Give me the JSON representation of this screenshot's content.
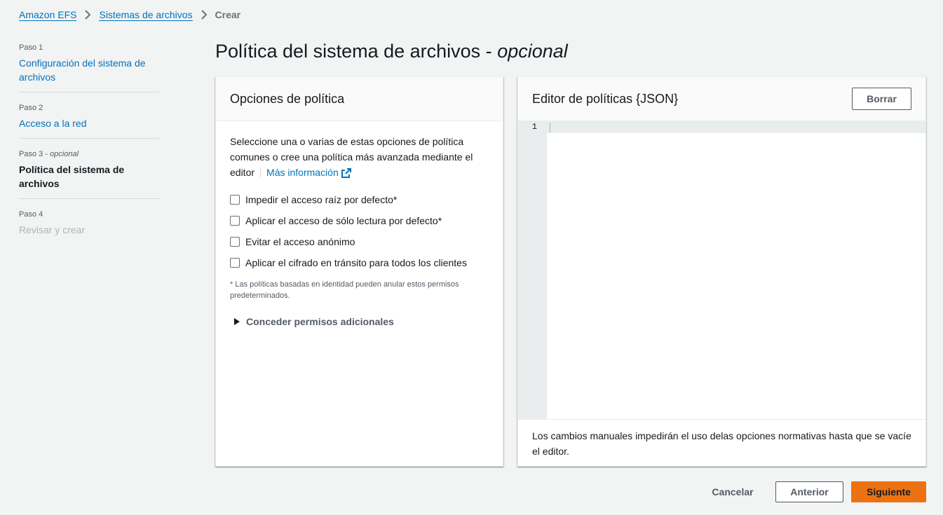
{
  "breadcrumb": {
    "items": [
      "Amazon EFS",
      "Sistemas de archivos"
    ],
    "current": "Crear"
  },
  "steps": [
    {
      "num": "Paso 1",
      "title": "Configuración del sistema de archivos",
      "state": "link"
    },
    {
      "num": "Paso 2",
      "title": "Acceso a la red",
      "state": "link"
    },
    {
      "num": "Paso 3",
      "num_suffix": "opcional",
      "title": "Política del sistema de archivos",
      "state": "active"
    },
    {
      "num": "Paso 4",
      "title": "Revisar y crear",
      "state": "disabled"
    }
  ],
  "page": {
    "title": "Política del sistema de archivos -",
    "title_suffix": "opcional"
  },
  "policy_options": {
    "header": "Opciones de política",
    "description": "Seleccione una o varias de estas opciones de política comunes o cree una política más avanzada mediante el editor",
    "info_link": "Más información",
    "options": [
      "Impedir el acceso raíz por defecto*",
      "Aplicar el acceso de sólo lectura por defecto*",
      "Evitar el acceso anónimo",
      "Aplicar el cifrado en tránsito para todos los clientes"
    ],
    "footnote": "* Las políticas basadas en identidad pueden anular estos permisos predeterminados.",
    "expander": "Conceder permisos adicionales"
  },
  "editor": {
    "header": "Editor de políticas {JSON}",
    "clear_label": "Borrar",
    "line_number": "1",
    "note": "Los cambios manuales impedirán el uso delas opciones normativas hasta que se vacíe el editor."
  },
  "footer": {
    "cancel": "Cancelar",
    "previous": "Anterior",
    "next": "Siguiente"
  },
  "colors": {
    "link": "#0073bb",
    "primary": "#ec7211",
    "background": "#f2f3f3"
  }
}
